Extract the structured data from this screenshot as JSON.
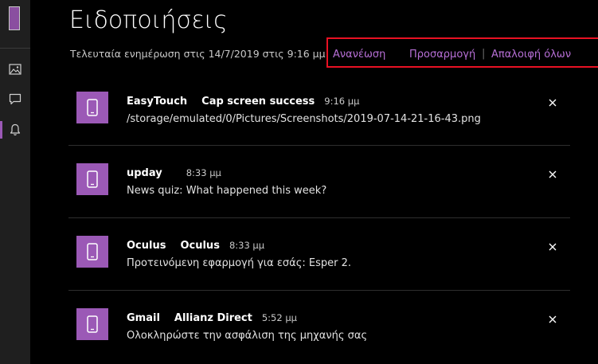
{
  "rail": {
    "items": [
      {
        "name": "photos-icon"
      },
      {
        "name": "messages-icon"
      },
      {
        "name": "notifications-icon"
      }
    ]
  },
  "header": {
    "title": "Ειδοποιήσεις",
    "last_updated": "Τελευταία ενημέρωση στις 14/7/2019 στις 9:16 μμ",
    "refresh_label": "Ανανέωση",
    "customize_label": "Προσαρμογή",
    "separator": "|",
    "clear_all_label": "Απαλοιφή όλων"
  },
  "notifications": [
    {
      "app": "EasyTouch",
      "title": "Cap screen success",
      "time": "9:16 μμ",
      "body": "/storage/emulated/0/Pictures/Screenshots/2019-07-14-21-16-43.png"
    },
    {
      "app": "upday",
      "title": "",
      "time": "8:33 μμ",
      "body": "News quiz: What happened this week?"
    },
    {
      "app": "Oculus",
      "title": "Oculus",
      "time": "8:33 μμ",
      "body": "Προτεινόμενη εφαρμογή για εσάς: Esper 2."
    },
    {
      "app": "Gmail",
      "title": "Allianz Direct",
      "time": "5:52 μμ",
      "body": "Ολοκληρώστε την ασφάλιση της μηχανής σας"
    }
  ],
  "colors": {
    "accent": "#9b59b6",
    "link": "#b76fd6",
    "highlight_box": "#e81123"
  }
}
